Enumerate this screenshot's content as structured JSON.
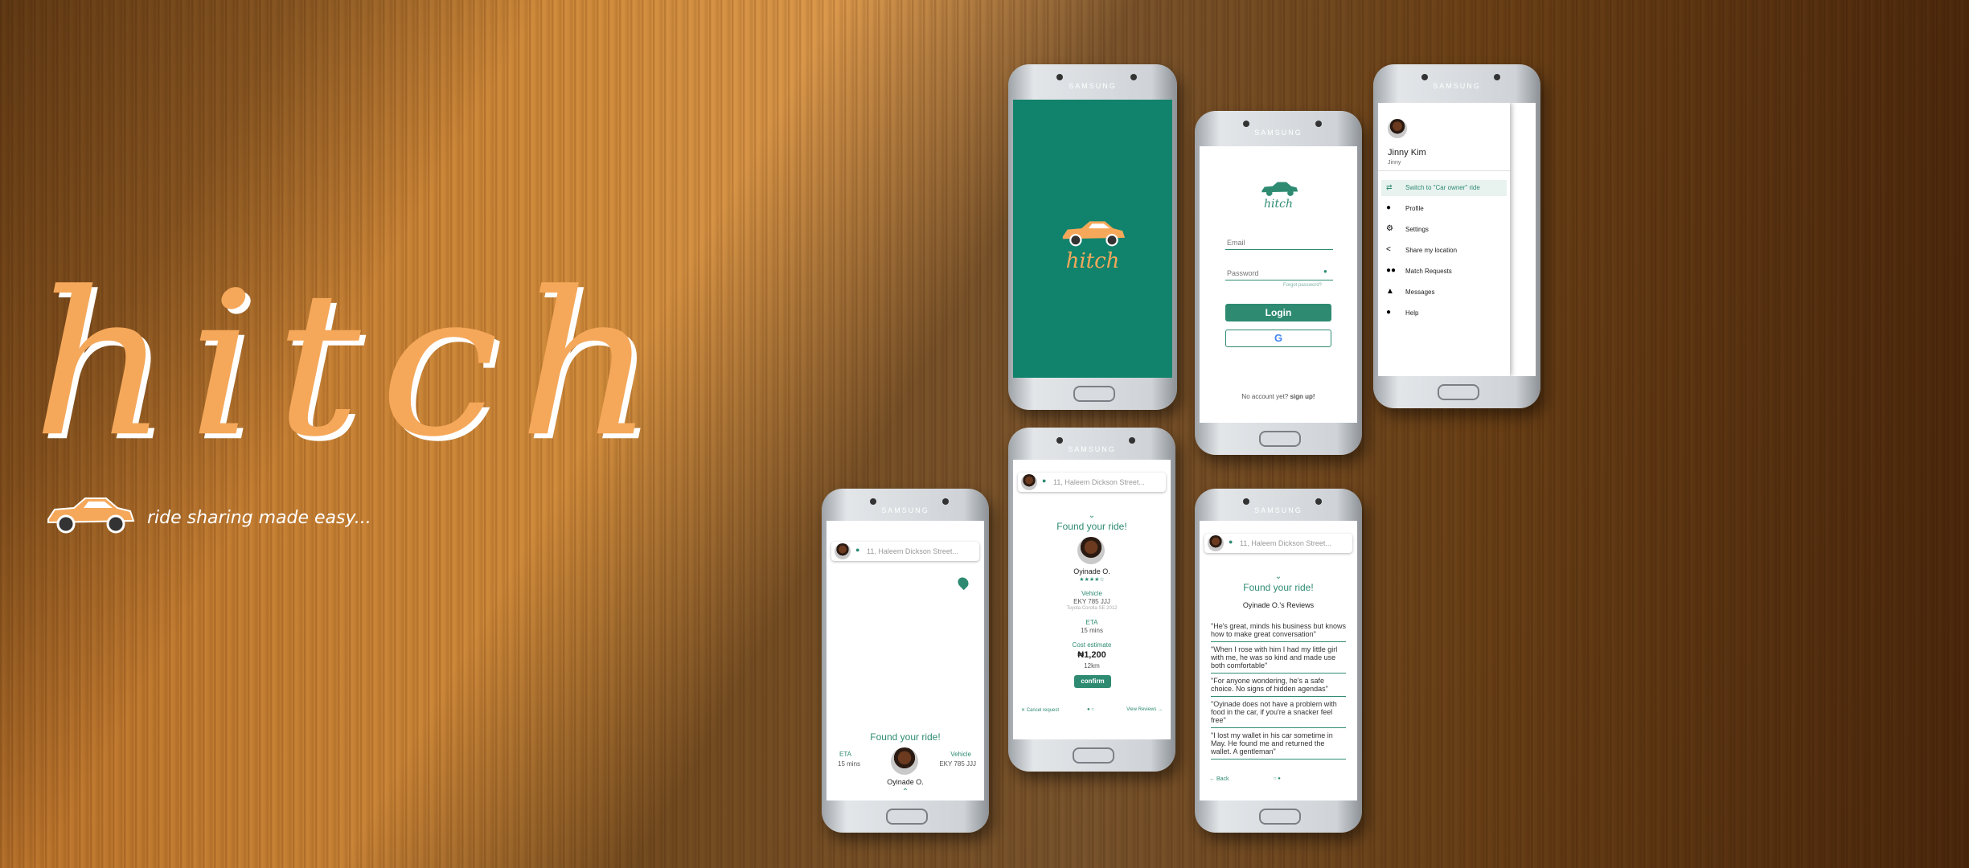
{
  "hero": {
    "logo": "hitch",
    "tagline": "ride sharing made easy..."
  },
  "colors": {
    "accent": "#2e8b72",
    "brand_orange": "#f5a85a"
  },
  "phones": {
    "splash": {
      "brand": "SAMSUNG",
      "logo": "hitch"
    },
    "login": {
      "brand": "SAMSUNG",
      "logo": "hitch",
      "email_placeholder": "Email",
      "password_placeholder": "Password",
      "forgot": "Forgot password?",
      "login_label": "Login",
      "google_label": "G",
      "no_account": "No account yet?",
      "signup": "sign up!"
    },
    "menu": {
      "brand": "SAMSUNG",
      "user_name": "Jinny Kim",
      "user_handle": "Jinny",
      "items": [
        {
          "label": "Switch to \"Car owner\" ride",
          "icon": "swap-icon"
        },
        {
          "label": "Profile",
          "icon": "person-icon"
        },
        {
          "label": "Settings",
          "icon": "gear-icon"
        },
        {
          "label": "Share my location",
          "icon": "share-icon"
        },
        {
          "label": "Match Requests",
          "icon": "people-icon"
        },
        {
          "label": "Messages",
          "icon": "bell-icon"
        },
        {
          "label": "Help",
          "icon": "info-icon"
        }
      ]
    },
    "map_view": {
      "brand": "SAMSUNG",
      "search": "11, Haleem Dickson Street...",
      "found": "Found your ride!",
      "eta_label": "ETA",
      "eta_value": "15 mins",
      "vehicle_label": "Vehicle",
      "vehicle_value": "EKY 785 JJJ",
      "driver": "Oyinade O."
    },
    "details": {
      "brand": "SAMSUNG",
      "search": "11, Haleem Dickson Street...",
      "found": "Found your ride!",
      "driver": "Oyinade O.",
      "stars": "★★★★☆",
      "vehicle_label": "Vehicle",
      "vehicle_value": "EKY 785 JJJ",
      "vehicle_model": "Toyota Corolla SE 2012",
      "eta_label": "ETA",
      "eta_value": "15 mins",
      "cost_label": "Cost estimate",
      "cost_value": "₦1,200",
      "distance": "12km",
      "confirm": "confirm",
      "cancel": "Cancel request",
      "view_reviews": "View Reviews"
    },
    "reviews": {
      "brand": "SAMSUNG",
      "search": "11, Haleem Dickson Street...",
      "found": "Found your ride!",
      "heading": "Oyinade O.'s Reviews",
      "items": [
        "\"He's great, minds his business but knows how to make great conversation\"",
        "\"When I rose with him I had my little girl with me, he was so kind and made use both comfortable\"",
        "\"For anyone wondering, he's a safe choice. No signs of hidden agendas\"",
        "\"Oyinade does not have a problem with food in the car, if you're a snacker feel free\"",
        "\"I lost my wallet in his car sometime in May. He found me and returned the wallet. A gentleman\""
      ],
      "back": "Back"
    }
  }
}
